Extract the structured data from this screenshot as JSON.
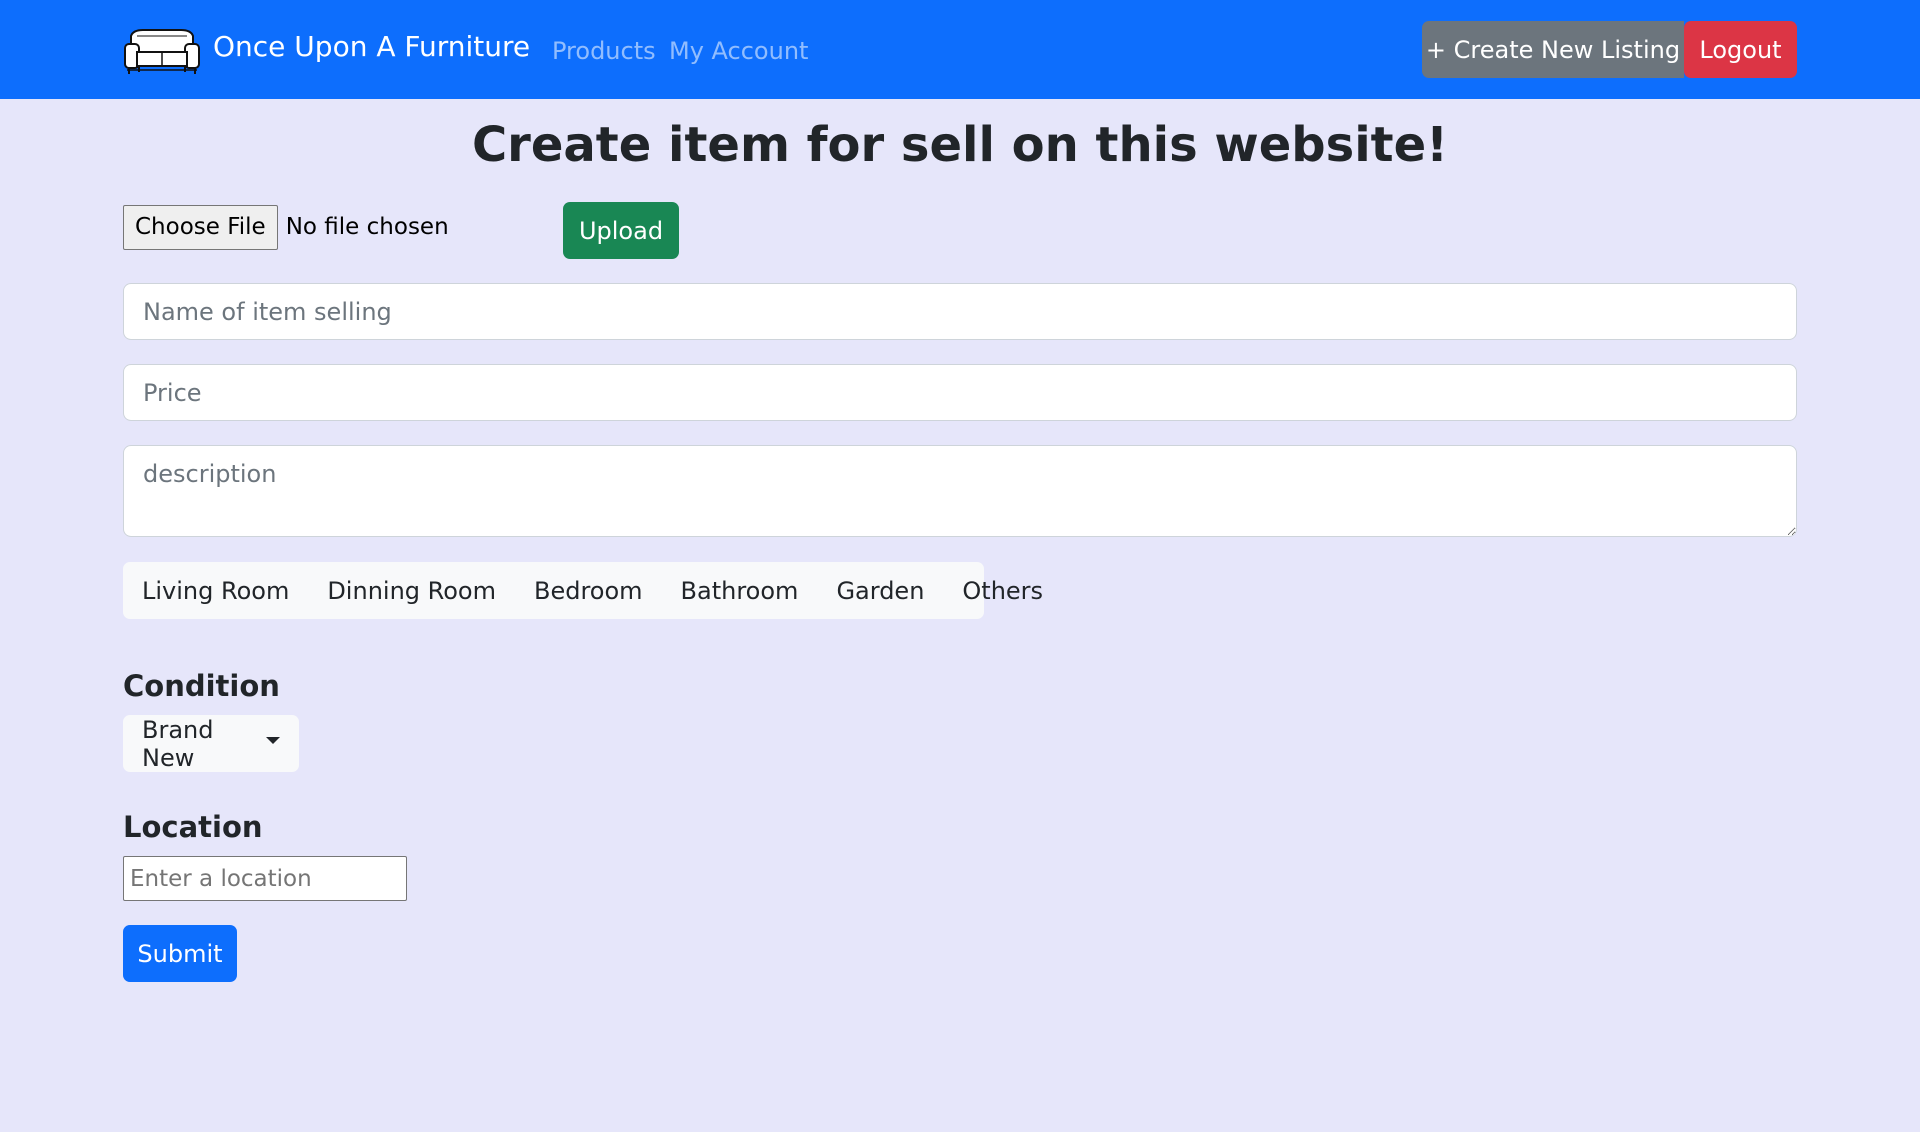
{
  "nav": {
    "brand": "Once Upon A Furniture",
    "logo_icon": "sofa-icon",
    "links": [
      "Products",
      "My Account"
    ],
    "create_label": "+ Create New Listing",
    "logout_label": "Logout"
  },
  "page": {
    "title": "Create item for sell on this website!"
  },
  "upload": {
    "choose_label": "Choose File",
    "status": "No file chosen",
    "upload_label": "Upload"
  },
  "form": {
    "name_placeholder": "Name of item selling",
    "price_placeholder": "Price",
    "description_placeholder": "description",
    "categories": [
      "Living Room",
      "Dinning Room",
      "Bedroom",
      "Bathroom",
      "Garden",
      "Others"
    ],
    "condition_label": "Condition",
    "condition_value": "Brand New",
    "location_label": "Location",
    "location_placeholder": "Enter a location",
    "submit_label": "Submit"
  },
  "colors": {
    "navbar": "#0d6efd",
    "background": "#e6e6fa",
    "create_button": "#6c757d",
    "logout_button": "#dc3545",
    "upload_button": "#198754",
    "submit_button": "#0d6efd"
  }
}
